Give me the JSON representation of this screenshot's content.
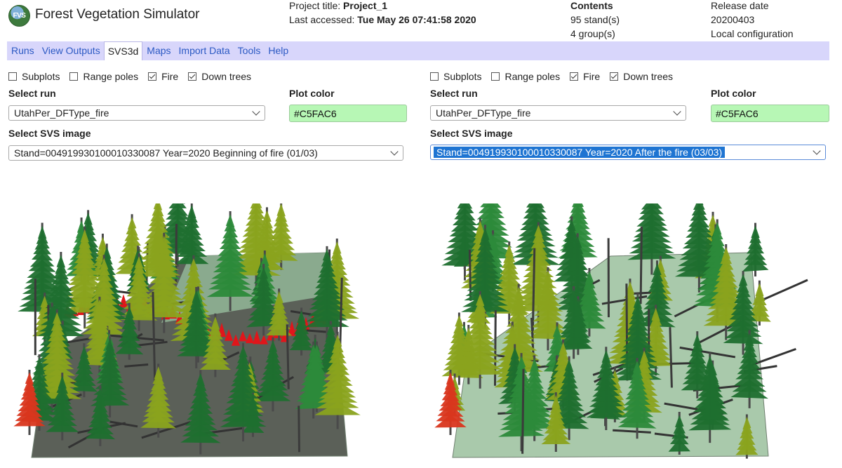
{
  "app": {
    "logo_text": "FVS",
    "title": "Forest Vegetation Simulator"
  },
  "header": {
    "project_label": "Project title:",
    "project_title": "Project_1",
    "accessed_label": "Last accessed:",
    "accessed": "Tue May 26 07:41:58 2020",
    "contents_label": "Contents",
    "stands": "95 stand(s)",
    "groups": "4 group(s)",
    "release_label": "Release date",
    "release_date": "20200403",
    "config": "Local configuration"
  },
  "menu": [
    "Runs",
    "View Outputs",
    "SVS3d",
    "Maps",
    "Import Data",
    "Tools",
    "Help"
  ],
  "left": {
    "checkboxes": [
      {
        "label": "Subplots",
        "checked": false
      },
      {
        "label": "Range poles",
        "checked": false
      },
      {
        "label": "Fire",
        "checked": true
      },
      {
        "label": "Down trees",
        "checked": true
      }
    ],
    "select_run_label": "Select run",
    "run": "UtahPer_DFType_fire",
    "plot_color_label": "Plot color",
    "plot_color": "#C5FAC6",
    "svs_label": "Select SVS image",
    "svs": "Stand=004919930100010330087 Year=2020 Beginning of fire (01/03)"
  },
  "right": {
    "checkboxes": [
      {
        "label": "Subplots",
        "checked": false
      },
      {
        "label": "Range poles",
        "checked": false
      },
      {
        "label": "Fire",
        "checked": true
      },
      {
        "label": "Down trees",
        "checked": true
      }
    ],
    "select_run_label": "Select run",
    "run": "UtahPer_DFType_fire",
    "plot_color_label": "Plot color",
    "plot_color": "#C5FAC6",
    "svs_label": "Select SVS image",
    "svs": "Stand=004919930100010330087 Year=2020 After the fire (03/03)"
  },
  "colors": {
    "menubar": "#d8d6fb",
    "link": "#2b59c3",
    "plot_color_field": "#b7f7b5",
    "burned_ground": "#5b6058",
    "plot_ground": "#a9c9ab",
    "conifer_dark": "#1f6f2f",
    "conifer_yellow": "#8aa31e",
    "fire": "#e0161b"
  }
}
